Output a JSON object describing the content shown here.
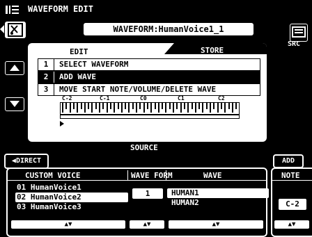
{
  "header": {
    "title": "WAVEFORM EDIT",
    "waveform_name": "WAVEFORM:HumanVoice1_1",
    "src_label": "SRC"
  },
  "tabs": {
    "edit": "EDIT",
    "store": "STORE"
  },
  "menu": [
    {
      "num": "1",
      "label": "SELECT WAVEFORM"
    },
    {
      "num": "2",
      "label": "ADD WAVE"
    },
    {
      "num": "3",
      "label": "MOVE START NOTE/VOLUME/DELETE WAVE"
    }
  ],
  "keyboard": {
    "labels": [
      "C-2",
      "C-1",
      "C0",
      "C1",
      "C2"
    ]
  },
  "buttons": {
    "direct": "DIRECT",
    "add": "ADD"
  },
  "source": {
    "title": "SOURCE",
    "headers": {
      "custom_voice": "CUSTOM VOICE",
      "wave_form": "WAVE FORM",
      "wave": "WAVE",
      "note": "NOTE"
    },
    "custom_voices": [
      {
        "num": "01",
        "name": "HumanVoice1"
      },
      {
        "num": "02",
        "name": "HumanVoice2"
      },
      {
        "num": "03",
        "name": "HumanVoice3"
      }
    ],
    "selected_voice_index": 1,
    "wave_form_number": "1",
    "waves": [
      "HUMAN1",
      "HUMAN2"
    ],
    "selected_wave_index": 0,
    "note": "C-2",
    "scroll_glyph": "▲▼"
  },
  "icons": [
    "menu-icon",
    "back-icon",
    "up-arrow-icon",
    "down-arrow-icon",
    "src-icon"
  ]
}
